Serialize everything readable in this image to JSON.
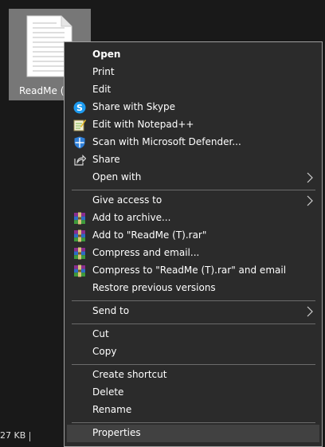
{
  "file": {
    "label": "ReadMe (T)"
  },
  "status": {
    "size": "27 KB"
  },
  "menu": {
    "items": [
      {
        "label": "Open",
        "icon": ""
      },
      {
        "label": "Print",
        "icon": ""
      },
      {
        "label": "Edit",
        "icon": ""
      },
      {
        "label": "Share with Skype",
        "icon": "skype-icon"
      },
      {
        "label": "Edit with Notepad++",
        "icon": "notepadpp-icon"
      },
      {
        "label": "Scan with Microsoft Defender...",
        "icon": "defender-icon"
      },
      {
        "label": "Share",
        "icon": "share-icon"
      },
      {
        "label": "Open with",
        "icon": ""
      },
      {
        "label": "Give access to",
        "icon": ""
      },
      {
        "label": "Add to archive...",
        "icon": "winrar-icon"
      },
      {
        "label": "Add to \"ReadMe (T).rar\"",
        "icon": "winrar-icon"
      },
      {
        "label": "Compress and email...",
        "icon": "winrar-icon"
      },
      {
        "label": "Compress to \"ReadMe (T).rar\" and email",
        "icon": "winrar-icon"
      },
      {
        "label": "Restore previous versions",
        "icon": ""
      },
      {
        "label": "Send to",
        "icon": ""
      },
      {
        "label": "Cut",
        "icon": ""
      },
      {
        "label": "Copy",
        "icon": ""
      },
      {
        "label": "Create shortcut",
        "icon": ""
      },
      {
        "label": "Delete",
        "icon": ""
      },
      {
        "label": "Rename",
        "icon": ""
      },
      {
        "label": "Properties",
        "icon": ""
      }
    ]
  }
}
